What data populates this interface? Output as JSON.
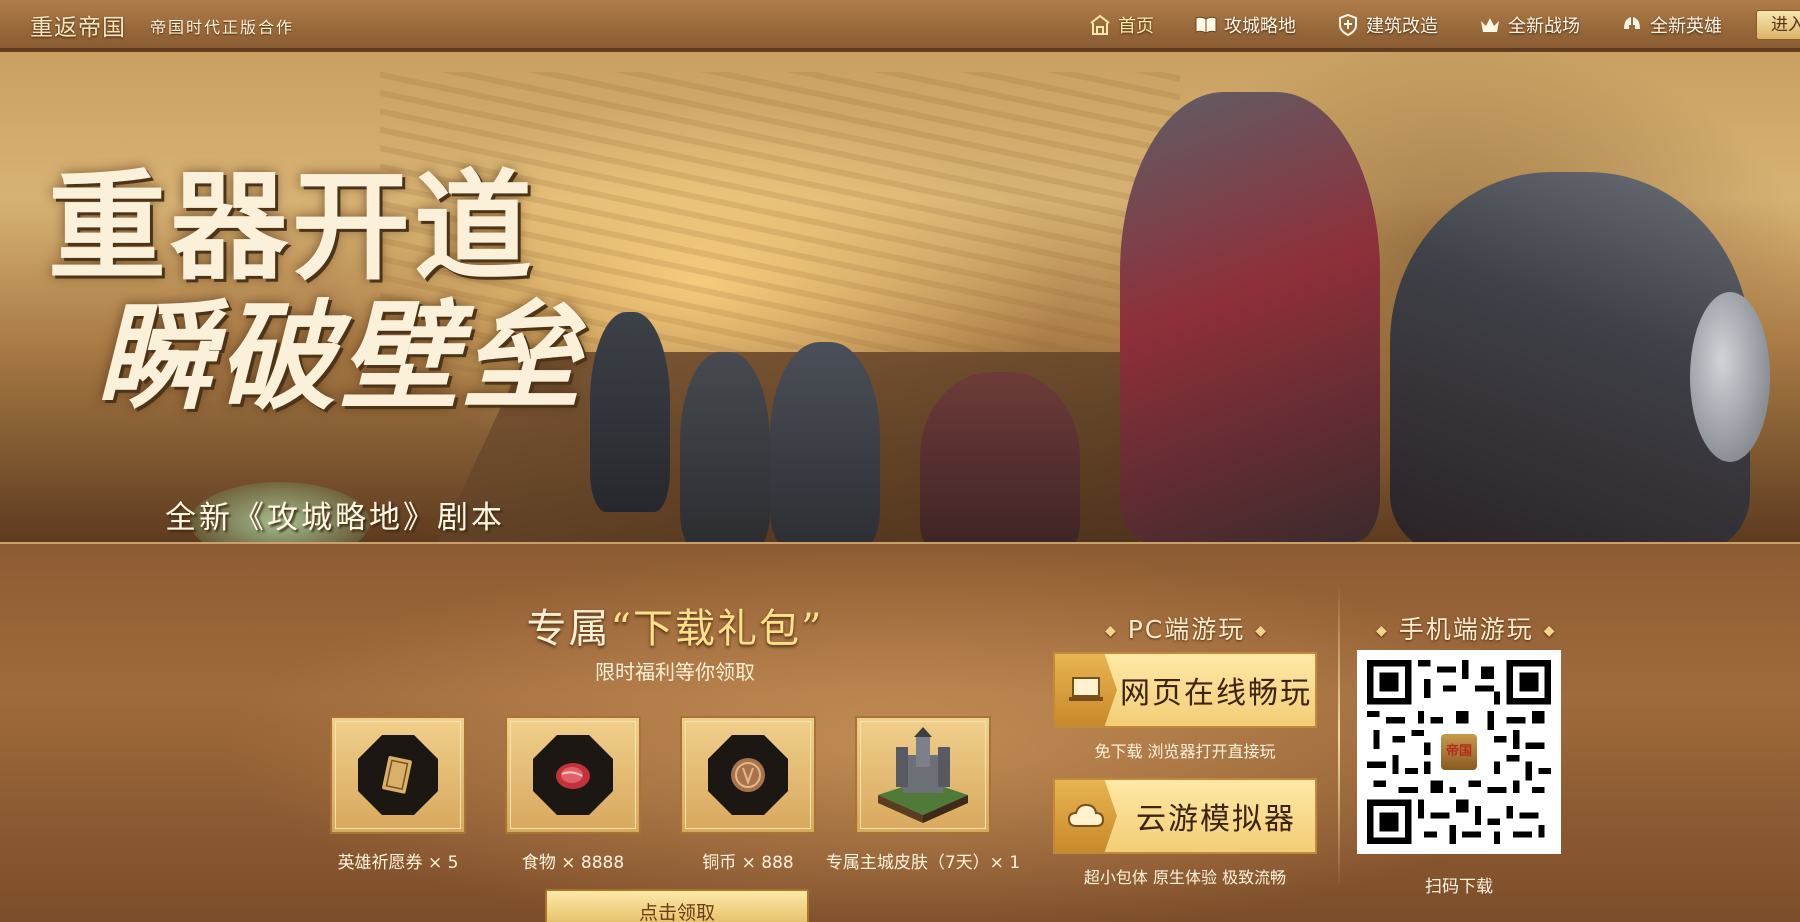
{
  "header": {
    "logo_text": "重返帝国",
    "tagline": "帝国时代正版合作",
    "nav": [
      {
        "label": "首页",
        "icon": "home-icon",
        "active": true
      },
      {
        "label": "攻城略地",
        "icon": "book-icon",
        "active": false
      },
      {
        "label": "建筑改造",
        "icon": "shield-icon",
        "active": false
      },
      {
        "label": "全新战场",
        "icon": "crown-icon",
        "active": false
      },
      {
        "label": "全新英雄",
        "icon": "helmet-icon",
        "active": false
      }
    ],
    "enter_label": "进入"
  },
  "banner": {
    "slogan_line1": "重器开道",
    "slogan_line2": "瞬破壁垒",
    "subtitle": "全新《攻城略地》剧本"
  },
  "gift_pack": {
    "title_prefix": "专属",
    "title_highlight": "“下载礼包”",
    "subtitle": "限时福利等你领取",
    "items": [
      {
        "label": "英雄祈愿券 × 5",
        "icon": "ticket-icon"
      },
      {
        "label": "食物 × 8888",
        "icon": "meat-icon"
      },
      {
        "label": "铜币 × 888",
        "icon": "coin-icon"
      },
      {
        "label": "专属主城皮肤（7天）× 1",
        "icon": "castle-icon"
      }
    ],
    "claim_label": "点击领取"
  },
  "pc_play": {
    "title": "PC端游玩",
    "web_button": "网页在线畅玩",
    "web_desc": "免下载 浏览器打开直接玩",
    "cloud_button": "云游模拟器",
    "cloud_desc": "超小包体 原生体验 极致流畅"
  },
  "mobile_play": {
    "title": "手机端游玩",
    "qr_badge": "帝国",
    "qr_label": "扫码下载"
  },
  "colors": {
    "nav_bg": "#9a6a3b",
    "panel_bg": "#9f6a3c",
    "button_gold": "#f2cd76",
    "text_light": "#fff3dc"
  }
}
